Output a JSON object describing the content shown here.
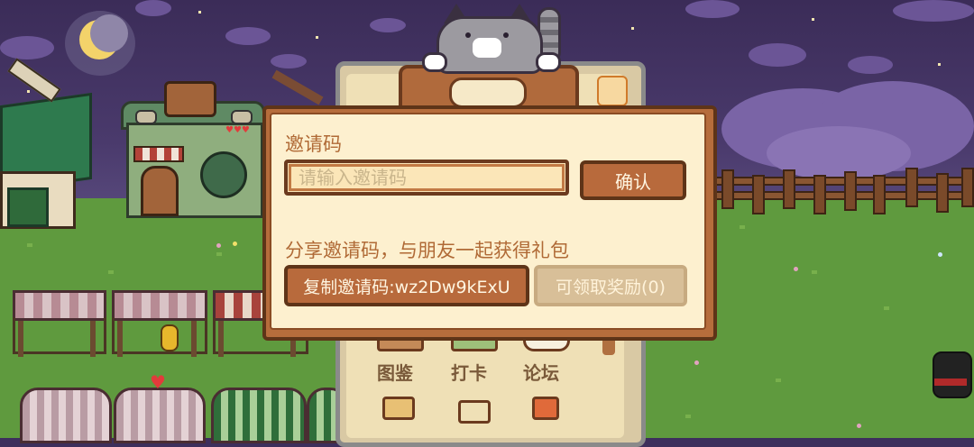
{
  "dialog": {
    "invite_code_title": "邀请码",
    "input_placeholder": "请输入邀请码",
    "confirm_label": "确认",
    "share_title": "分享邀请码，与朋友一起获得礼包",
    "copy_button_label": "复制邀请码:wz2Dw9kExU",
    "claim_button_label": "可领取奖励(0)"
  },
  "menu": {
    "items": [
      {
        "label": "图鉴",
        "icon": "book-icon"
      },
      {
        "label": "打卡",
        "icon": "checkin-icon"
      },
      {
        "label": "论坛",
        "icon": "chat-icon"
      }
    ]
  },
  "colors": {
    "dialog_border": "#b66d3c",
    "dialog_bg": "#fdf0cf",
    "button": "#b86a3c",
    "button_disabled": "#d8bf98",
    "sky": "#3b2c58",
    "grass": "#5f9a3e"
  },
  "icons": [
    "moon-icon",
    "cat-mascot-icon",
    "mini-cat-icon",
    "black-cat-icon",
    "camera-icon",
    "corn-icon",
    "heart-icon"
  ]
}
